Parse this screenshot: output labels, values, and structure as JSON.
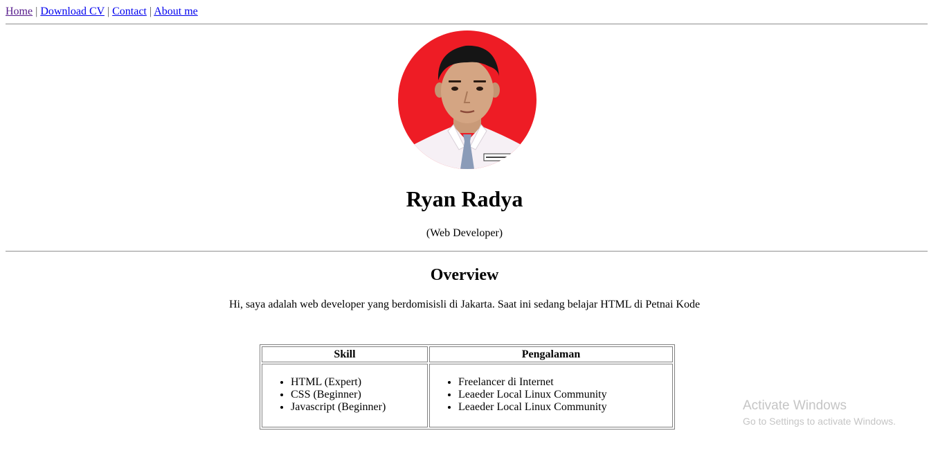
{
  "nav": {
    "links": [
      "Home",
      "Download CV",
      "Contact",
      "About me"
    ],
    "separator": "|"
  },
  "profile": {
    "name": "Ryan Radya",
    "role": "(Web Developer)",
    "photo_bg_color": "#ee1c25"
  },
  "overview": {
    "heading": "Overview",
    "text": "Hi, saya adalah web developer yang berdomisisli di Jakarta. Saat ini sedang belajar HTML di Petnai Kode"
  },
  "table": {
    "headers": [
      "Skill",
      "Pengalaman"
    ],
    "skills": [
      "HTML (Expert)",
      "CSS (Beginner)",
      "Javascript (Beginner)"
    ],
    "experience": [
      "Freelancer di Internet",
      "Leaeder Local Linux Community",
      "Leaeder Local Linux Community"
    ]
  },
  "watermark": {
    "line1": "Activate Windows",
    "line2": "Go to Settings to activate Windows."
  }
}
